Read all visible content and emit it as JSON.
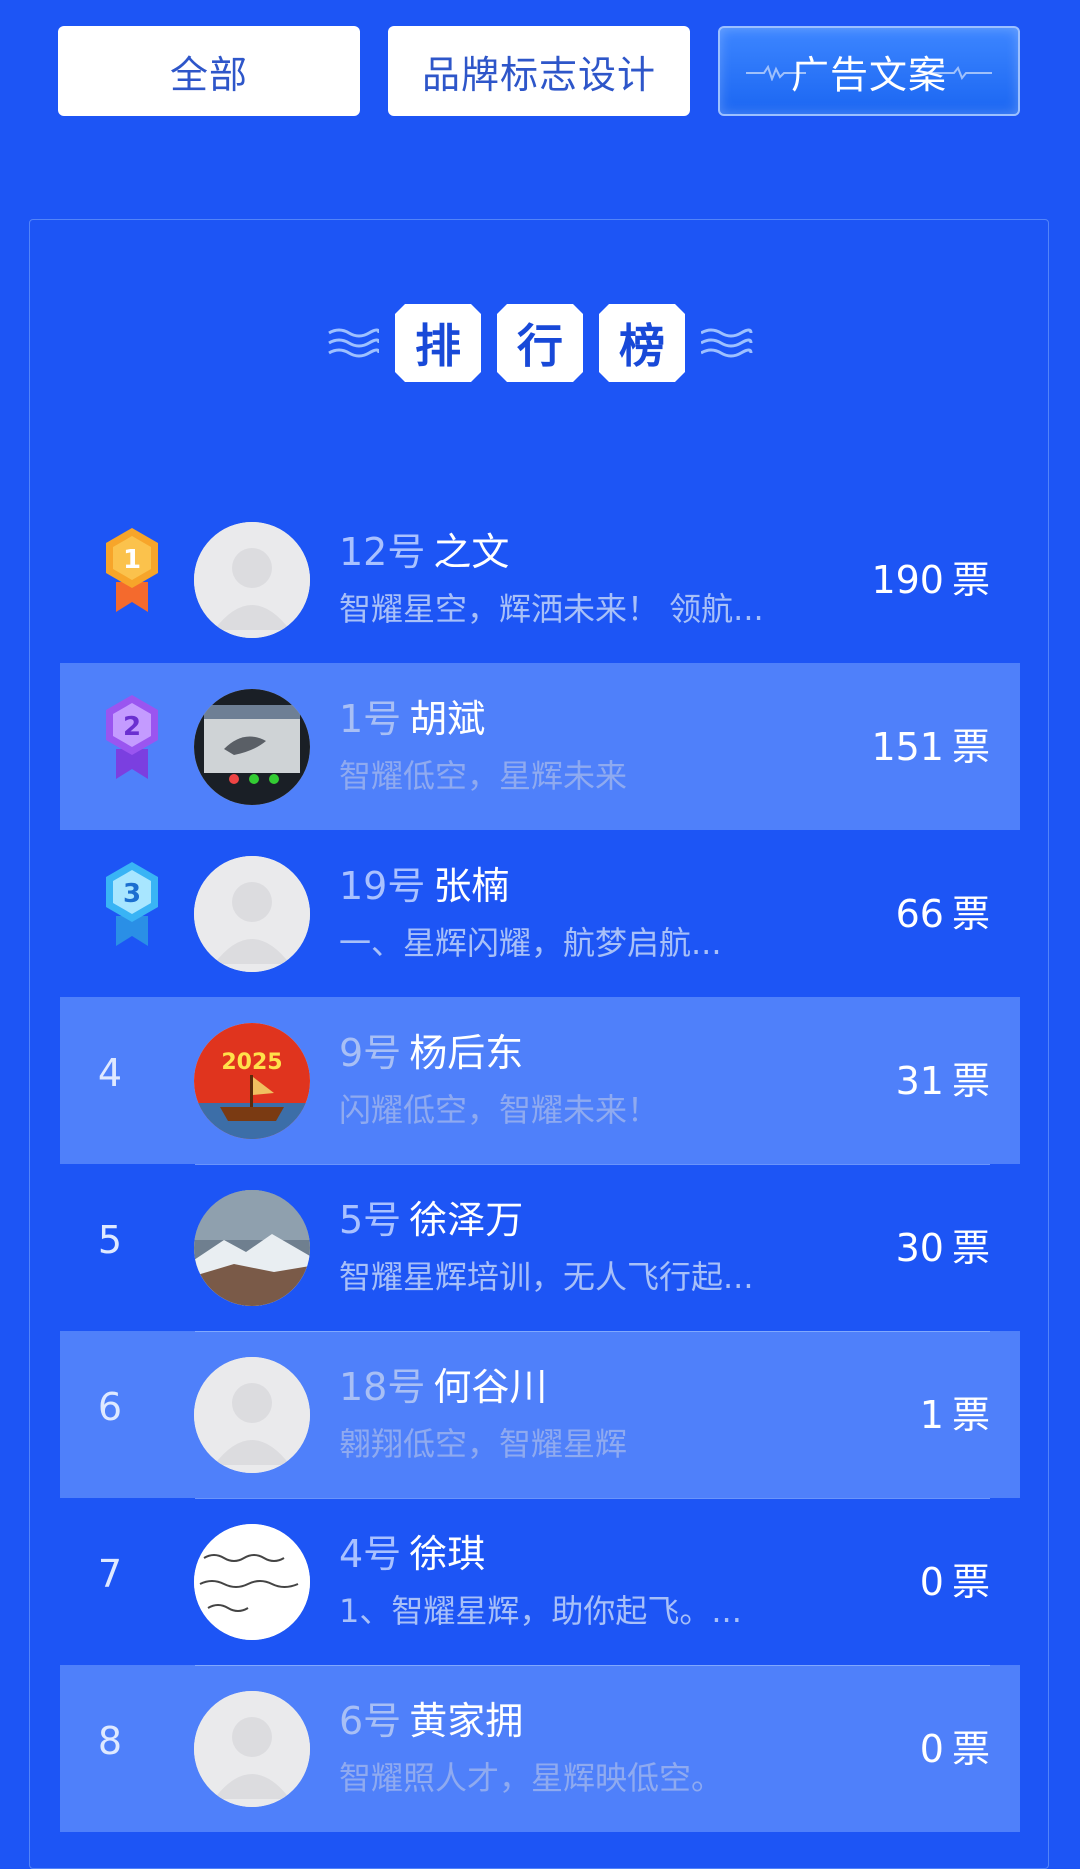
{
  "tabs": [
    {
      "label": "全部",
      "active": false
    },
    {
      "label": "品牌标志设计",
      "active": false
    },
    {
      "label": "广告文案",
      "active": true
    }
  ],
  "leaderboard": {
    "title_chars": [
      "排",
      "行",
      "榜"
    ],
    "vote_unit": "票",
    "entries": [
      {
        "rank": "1",
        "number": "12号",
        "name": "之文",
        "slogan": "智耀星空，辉洒未来！ 领航...",
        "votes": "190",
        "avatar": "placeholder-avatar",
        "medal": "gold"
      },
      {
        "rank": "2",
        "number": "1号",
        "name": "胡斌",
        "slogan": "智耀低空，星辉未来",
        "votes": "151",
        "avatar": "painting-photo",
        "medal": "purple"
      },
      {
        "rank": "3",
        "number": "19号",
        "name": "张楠",
        "slogan": "一、星辉闪耀，航梦启航...",
        "votes": "66",
        "avatar": "placeholder-avatar",
        "medal": "blue"
      },
      {
        "rank": "4",
        "number": "9号",
        "name": "杨后东",
        "slogan": "闪耀低空，智耀未来！",
        "votes": "31",
        "avatar": "2025-ship-poster",
        "avatar_text": "2025"
      },
      {
        "rank": "5",
        "number": "5号",
        "name": "徐泽万",
        "slogan": "智耀星辉培训，无人飞行起...",
        "votes": "30",
        "avatar": "mountain-photo"
      },
      {
        "rank": "6",
        "number": "18号",
        "name": "何谷川",
        "slogan": "翱翔低空，智耀星辉",
        "votes": "1",
        "avatar": "placeholder-avatar"
      },
      {
        "rank": "7",
        "number": "4号",
        "name": "徐琪",
        "slogan": "1、智耀星辉，助你起飞。...",
        "votes": "0",
        "avatar": "text-image"
      },
      {
        "rank": "8",
        "number": "6号",
        "name": "黄家拥",
        "slogan": "智耀照人才，星辉映低空。",
        "votes": "0",
        "avatar": "placeholder-avatar"
      }
    ]
  },
  "colors": {
    "background": "#1d55f5",
    "row_highlight": "#4f80fa",
    "tab_text": "#2e56c9",
    "gold": "#f7a52a",
    "purple": "#9a55f0",
    "blue": "#39b4f5"
  }
}
